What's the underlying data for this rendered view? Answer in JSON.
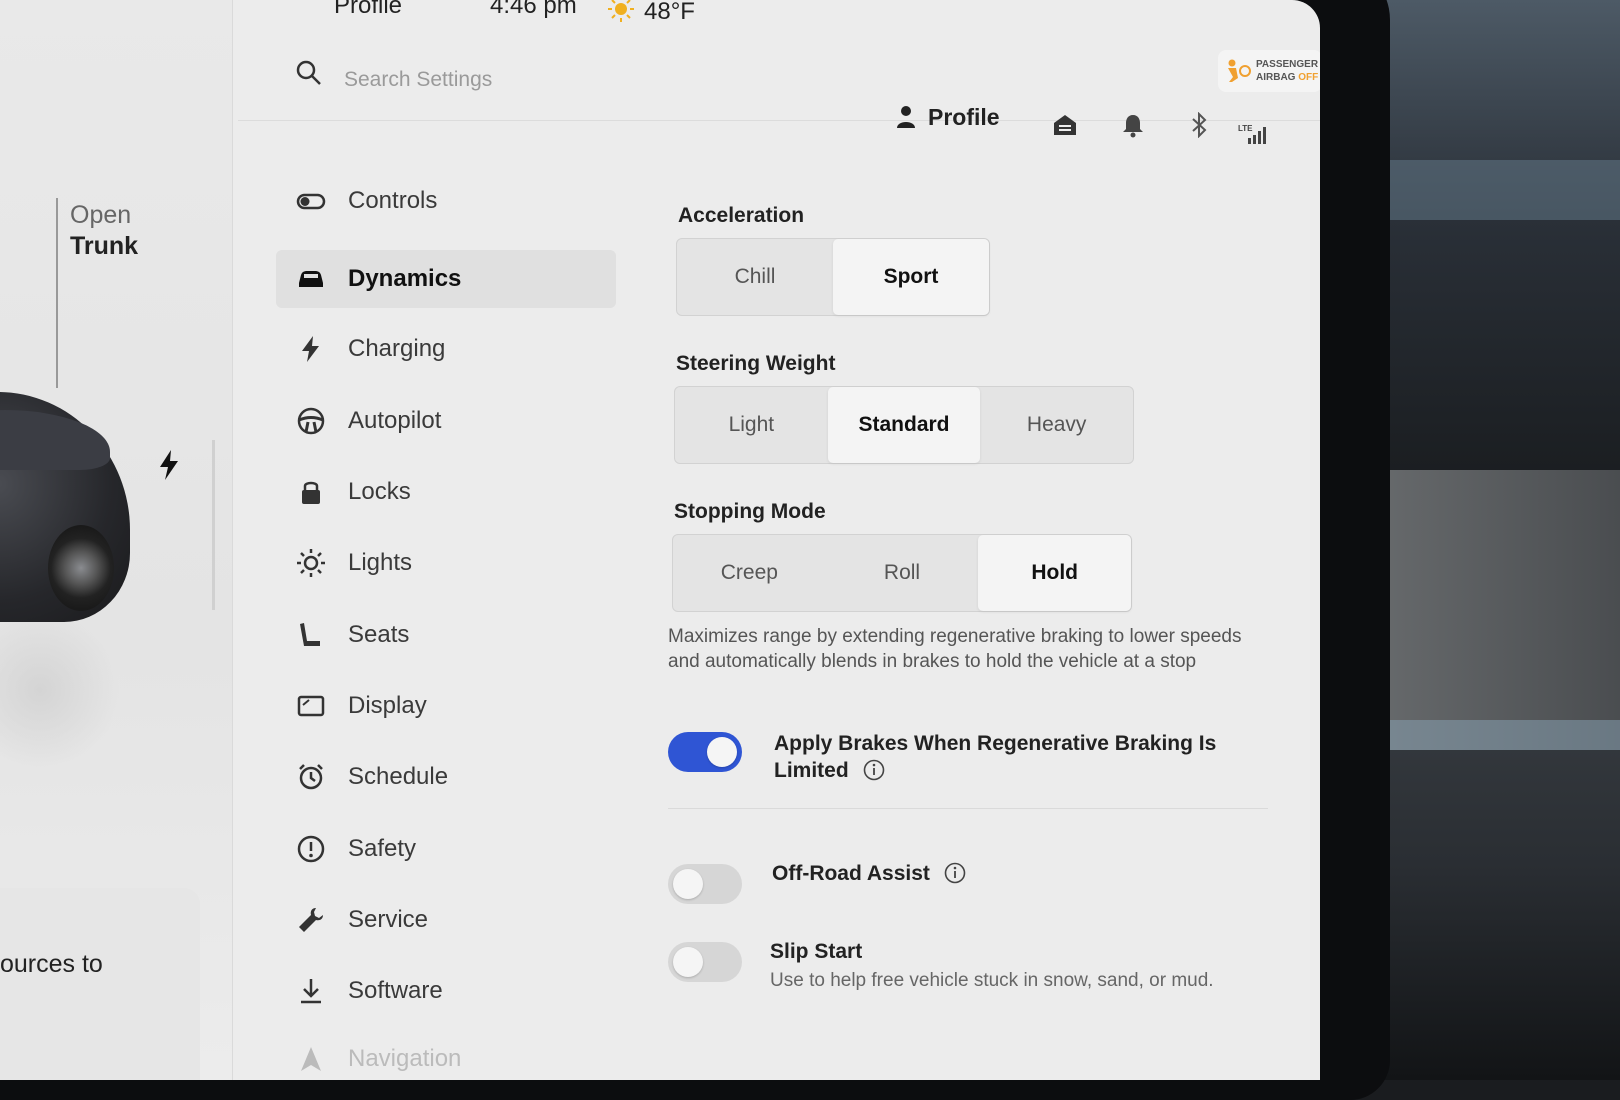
{
  "status": {
    "profile_short": "Profile",
    "time": "4:46 pm",
    "temperature": "48°F"
  },
  "search": {
    "placeholder": "Search Settings"
  },
  "header": {
    "profile_label": "Profile",
    "airbag_line1": "PASSENGER",
    "airbag_line2": "AIRBAG",
    "airbag_state": "OFF",
    "network_label": "LTE"
  },
  "car_panel": {
    "trunk_line1": "Open",
    "trunk_line2": "Trunk",
    "notice_text": "ources to"
  },
  "nav": {
    "items": [
      {
        "label": "Controls",
        "icon": "toggle-icon"
      },
      {
        "label": "Dynamics",
        "icon": "car-icon",
        "active": true
      },
      {
        "label": "Charging",
        "icon": "bolt-icon"
      },
      {
        "label": "Autopilot",
        "icon": "steering-wheel-icon"
      },
      {
        "label": "Locks",
        "icon": "lock-icon"
      },
      {
        "label": "Lights",
        "icon": "sun-icon"
      },
      {
        "label": "Seats",
        "icon": "seat-icon"
      },
      {
        "label": "Display",
        "icon": "display-icon"
      },
      {
        "label": "Schedule",
        "icon": "alarm-clock-icon"
      },
      {
        "label": "Safety",
        "icon": "alert-circle-icon"
      },
      {
        "label": "Service",
        "icon": "wrench-icon"
      },
      {
        "label": "Software",
        "icon": "download-icon"
      },
      {
        "label": "Navigation",
        "icon": "navigation-icon"
      }
    ]
  },
  "acceleration": {
    "title": "Acceleration",
    "options": [
      "Chill",
      "Sport"
    ],
    "selected": "Sport"
  },
  "steering": {
    "title": "Steering Weight",
    "options": [
      "Light",
      "Standard",
      "Heavy"
    ],
    "selected": "Standard"
  },
  "stopping": {
    "title": "Stopping Mode",
    "options": [
      "Creep",
      "Roll",
      "Hold"
    ],
    "selected": "Hold",
    "description": "Maximizes range by extending regenerative braking to lower speeds and automatically blends in brakes to hold the vehicle at a stop"
  },
  "toggles": {
    "apply_brakes": {
      "label": "Apply Brakes When Regenerative Braking Is Limited",
      "on": true
    },
    "off_road": {
      "label": "Off-Road Assist",
      "on": false
    },
    "slip_start": {
      "label": "Slip Start",
      "description": "Use to help free vehicle stuck in snow, sand, or mud.",
      "on": false
    }
  },
  "colors": {
    "toggle_on": "#2f55d4",
    "airbag_off": "#f0a030"
  }
}
